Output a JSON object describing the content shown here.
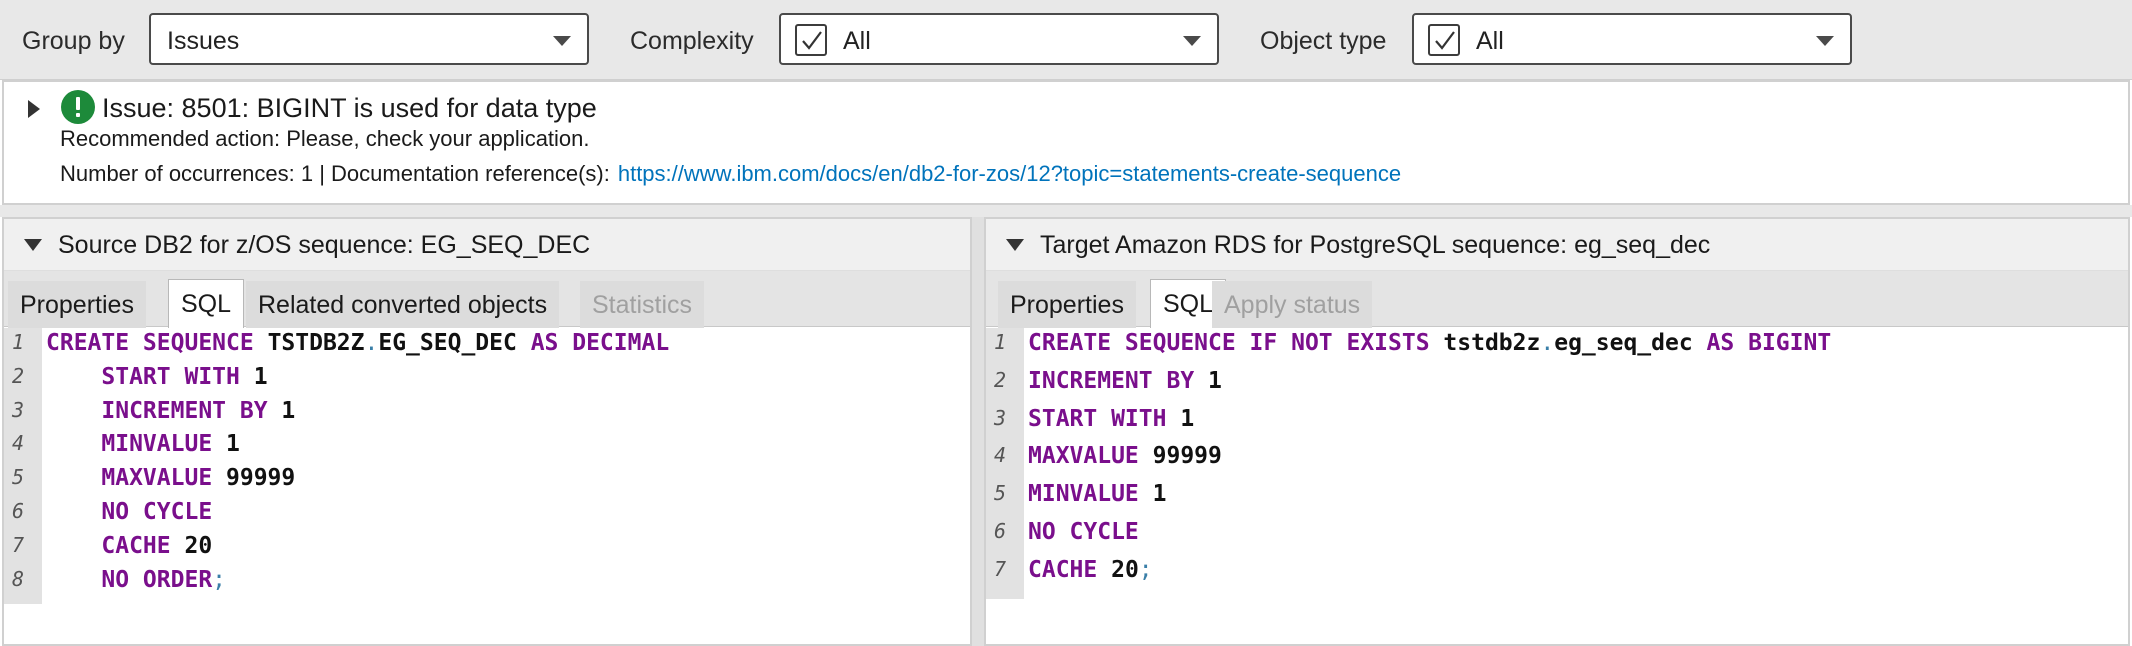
{
  "toolbar": {
    "group_by_label": "Group by",
    "group_by_value": "Issues",
    "complexity_label": "Complexity",
    "complexity_value": "All",
    "object_type_label": "Object type",
    "object_type_value": "All"
  },
  "issue": {
    "title": "Issue: 8501: BIGINT is used for data type",
    "recommended_action": "Recommended action: Please, check your application.",
    "occurrences": "Number of occurrences: 1 | Documentation reference(s):",
    "doc_link": "https://www.ibm.com/docs/en/db2-for-zos/12?topic=statements-create-sequence",
    "badge_icon": "exclamation-circle-icon",
    "badge_color": "#1d8a3a"
  },
  "source_panel": {
    "title": "Source DB2 for z/OS sequence: EG_SEQ_DEC",
    "tabs": [
      "Properties",
      "SQL",
      "Related converted objects",
      "Statistics"
    ],
    "active_tab": "SQL",
    "line_numbers": [
      "1",
      "2",
      "3",
      "4",
      "5",
      "6",
      "7",
      "8"
    ],
    "lines": [
      [
        {
          "t": "CREATE SEQUENCE ",
          "c": "kw"
        },
        {
          "t": "TSTDB2Z",
          "c": "id"
        },
        {
          "t": ".",
          "c": "dot"
        },
        {
          "t": "EG_SEQ_DEC",
          "c": "id"
        },
        {
          "t": " AS DECIMAL",
          "c": "kw"
        }
      ],
      [
        {
          "t": "    START WITH ",
          "c": "kw"
        },
        {
          "t": "1",
          "c": "num"
        }
      ],
      [
        {
          "t": "    INCREMENT BY ",
          "c": "kw"
        },
        {
          "t": "1",
          "c": "num"
        }
      ],
      [
        {
          "t": "    MINVALUE ",
          "c": "kw"
        },
        {
          "t": "1",
          "c": "num"
        }
      ],
      [
        {
          "t": "    MAXVALUE ",
          "c": "kw"
        },
        {
          "t": "99999",
          "c": "num"
        }
      ],
      [
        {
          "t": "    NO CYCLE",
          "c": "kw"
        }
      ],
      [
        {
          "t": "    CACHE ",
          "c": "kw"
        },
        {
          "t": "20",
          "c": "num"
        }
      ],
      [
        {
          "t": "    NO ORDER",
          "c": "kw"
        },
        {
          "t": ";",
          "c": "punc"
        }
      ]
    ]
  },
  "target_panel": {
    "title": "Target Amazon RDS for PostgreSQL sequence: eg_seq_dec",
    "tabs": [
      "Properties",
      "SQL",
      "Apply status"
    ],
    "active_tab": "SQL",
    "line_numbers": [
      "1",
      "2",
      "3",
      "4",
      "5",
      "6",
      "7"
    ],
    "lines": [
      [
        {
          "t": "CREATE SEQUENCE IF NOT EXISTS ",
          "c": "kw"
        },
        {
          "t": "tstdb2z",
          "c": "id"
        },
        {
          "t": ".",
          "c": "dot"
        },
        {
          "t": "eg_seq_dec",
          "c": "id"
        },
        {
          "t": " AS BIGINT",
          "c": "kw"
        }
      ],
      [
        {
          "t": "INCREMENT BY ",
          "c": "kw"
        },
        {
          "t": "1",
          "c": "num"
        }
      ],
      [
        {
          "t": "START WITH ",
          "c": "kw"
        },
        {
          "t": "1",
          "c": "num"
        }
      ],
      [
        {
          "t": "MAXVALUE ",
          "c": "kw"
        },
        {
          "t": "99999",
          "c": "num"
        }
      ],
      [
        {
          "t": "MINVALUE ",
          "c": "kw"
        },
        {
          "t": "1",
          "c": "num"
        }
      ],
      [
        {
          "t": "NO CYCLE",
          "c": "kw"
        }
      ],
      [
        {
          "t": "CACHE ",
          "c": "kw"
        },
        {
          "t": "20",
          "c": "num"
        },
        {
          "t": ";",
          "c": "punc"
        }
      ]
    ]
  }
}
